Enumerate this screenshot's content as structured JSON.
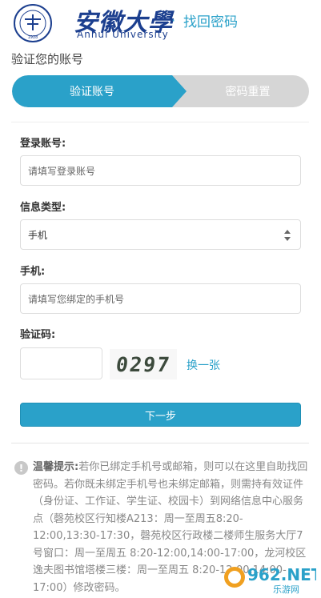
{
  "header": {
    "university_name_cn": "安徽大學",
    "university_name_en": "Anhui University",
    "separator": "·",
    "page_title": "找回密码",
    "seal_text": "1928",
    "seal_ring_text": "ANHUI UNIVERSITY"
  },
  "section_title": "验证您的账号",
  "steps": [
    {
      "label": "验证账号",
      "active": true
    },
    {
      "label": "密码重置",
      "active": false
    }
  ],
  "form": {
    "account": {
      "label": "登录账号:",
      "placeholder": "请填写登录账号"
    },
    "info_type": {
      "label": "信息类型:",
      "selected": "手机"
    },
    "phone": {
      "label": "手机:",
      "placeholder": "请填写您绑定的手机号"
    },
    "captcha": {
      "label": "验证码:",
      "image_text": "0297",
      "refresh_label": "换一张"
    },
    "submit_label": "下一步"
  },
  "tip": {
    "title": "温馨提示:",
    "body": "若你已绑定手机号或邮箱，则可以在这里自助找回密码。若你既未绑定手机号也未绑定邮箱，则需持有效证件（身份证、工作证、学生证、校园卡）到网络信息中心服务点（磬苑校区行知楼A213：周一至周五8:20-12:00,13:30-17:30，磬苑校区行政楼二楼师生服务大厅7号窗口：周一至周五 8:20-12:00,14:00-17:00，龙河校区逸夫图书馆塔楼三楼：周一至周五 8:20-12:00,14:00-17:00）修改密码。"
  },
  "watermark": {
    "text": "962.NET",
    "sub": "乐游网"
  },
  "colors": {
    "accent": "#2aa1c9",
    "brand_blue": "#1c3f8f",
    "inactive_step": "#d6d6d6"
  }
}
